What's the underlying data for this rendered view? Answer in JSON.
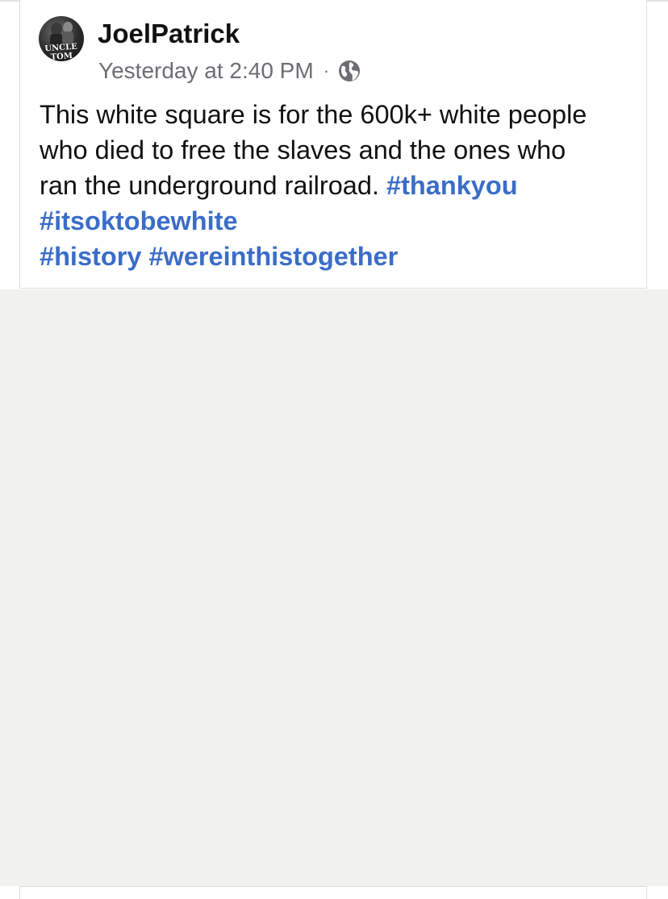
{
  "post": {
    "author": "JoelPatrick",
    "avatar_text": "UNCLE TOM",
    "timestamp": "Yesterday at 2:40 PM",
    "separator": "·",
    "privacy_icon": "globe-icon",
    "text_line_1": "This white square is for the 600k+ white people",
    "text_line_2": "who died to free the slaves and the ones who",
    "text_line_3_plain": "ran the underground railroad. ",
    "hashtags": [
      "#thankyou",
      "#itsoktobewhite",
      "#history",
      "#wereinthistogether"
    ]
  },
  "colors": {
    "hashtag": "#3b6dc7",
    "meta_text": "#6b6e73",
    "background_area": "#f1f1ef"
  }
}
